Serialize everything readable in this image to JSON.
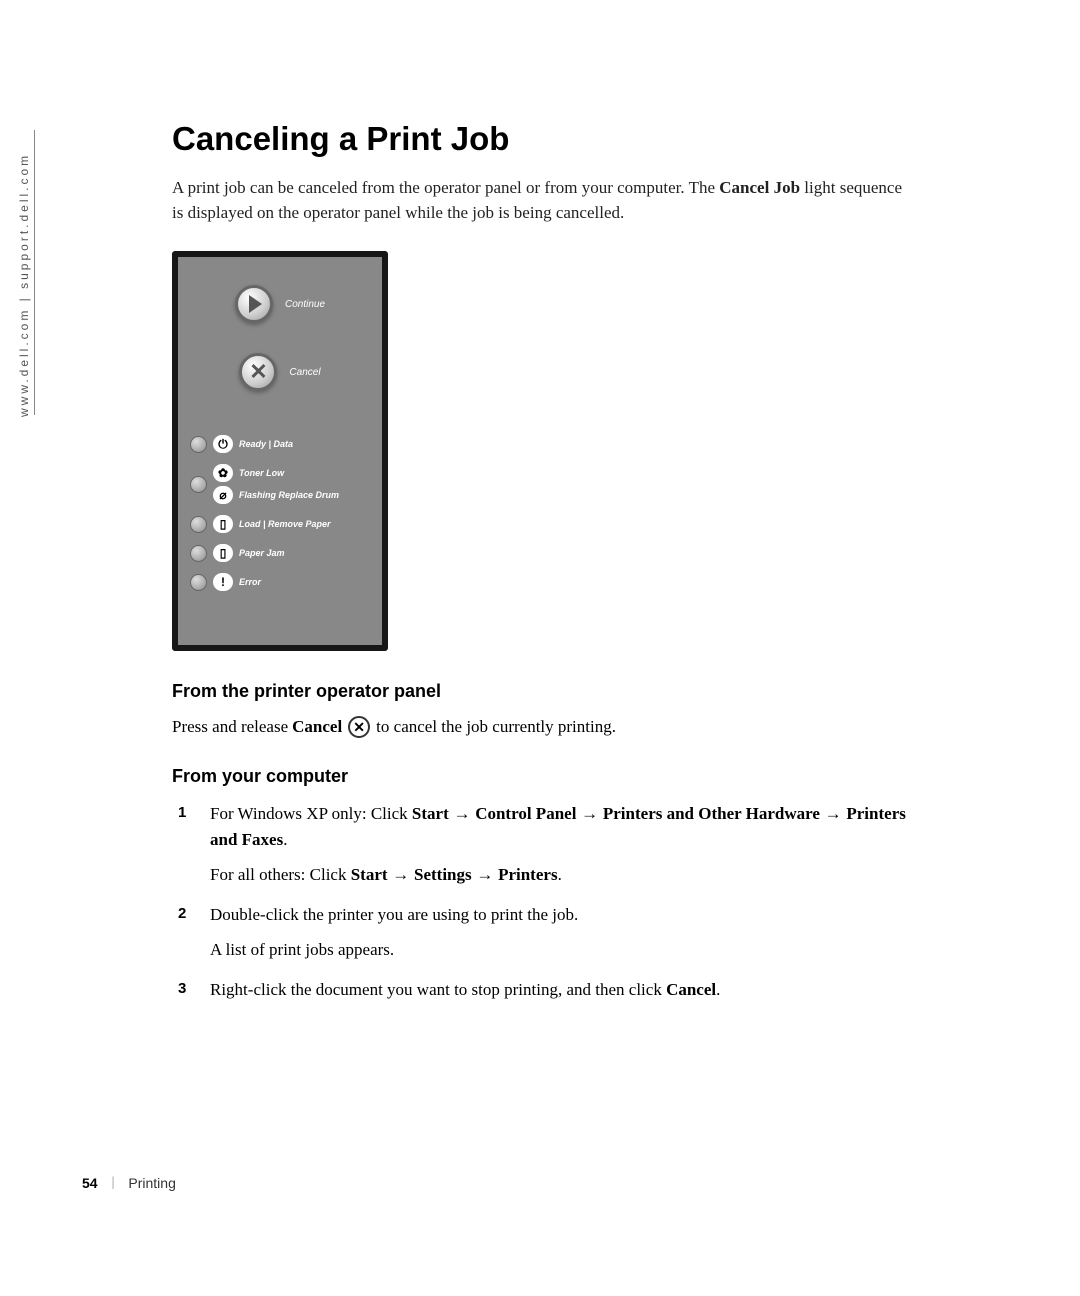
{
  "side_url": "www.dell.com | support.dell.com",
  "title": "Canceling a Print Job",
  "intro": {
    "pre": "A print job can be canceled from the operator panel or from your computer. The ",
    "bold": "Cancel Job",
    "post": " light sequence is displayed on the operator panel while the job is being cancelled."
  },
  "panel": {
    "continue_label": "Continue",
    "cancel_label": "Cancel",
    "ready": "Ready | Data",
    "toner_low": "Toner Low",
    "flashing": "Flashing Replace Drum",
    "load": "Load | Remove Paper",
    "jam": "Paper Jam",
    "error": "Error"
  },
  "sec1": {
    "heading": "From the printer operator panel",
    "pre": "Press and release ",
    "bold": "Cancel",
    "post": " to cancel the job currently printing."
  },
  "sec2": {
    "heading": "From your computer",
    "step1": {
      "pre": "For Windows XP only: Click ",
      "b1": "Start",
      "arrow": " → ",
      "b2": "Control Panel",
      "b3": "Printers and Other Hardware",
      "b4": "Printers and Faxes",
      "period": ".",
      "sub_pre": "For all others: Click ",
      "sb1": "Start",
      "sb2": "Settings",
      "sb3": "Printers"
    },
    "step2": {
      "line1": "Double-click the printer you are using to print the job.",
      "line2": "A list of print jobs appears."
    },
    "step3": {
      "pre": "Right-click the document you want to stop printing, and then click ",
      "bold": "Cancel",
      "post": "."
    }
  },
  "footer": {
    "page": "54",
    "section": "Printing"
  },
  "icons": {
    "power": "⏻",
    "drop": "✿",
    "drum": "⌀",
    "paper": "▯",
    "jam": "▯",
    "error": "!"
  }
}
